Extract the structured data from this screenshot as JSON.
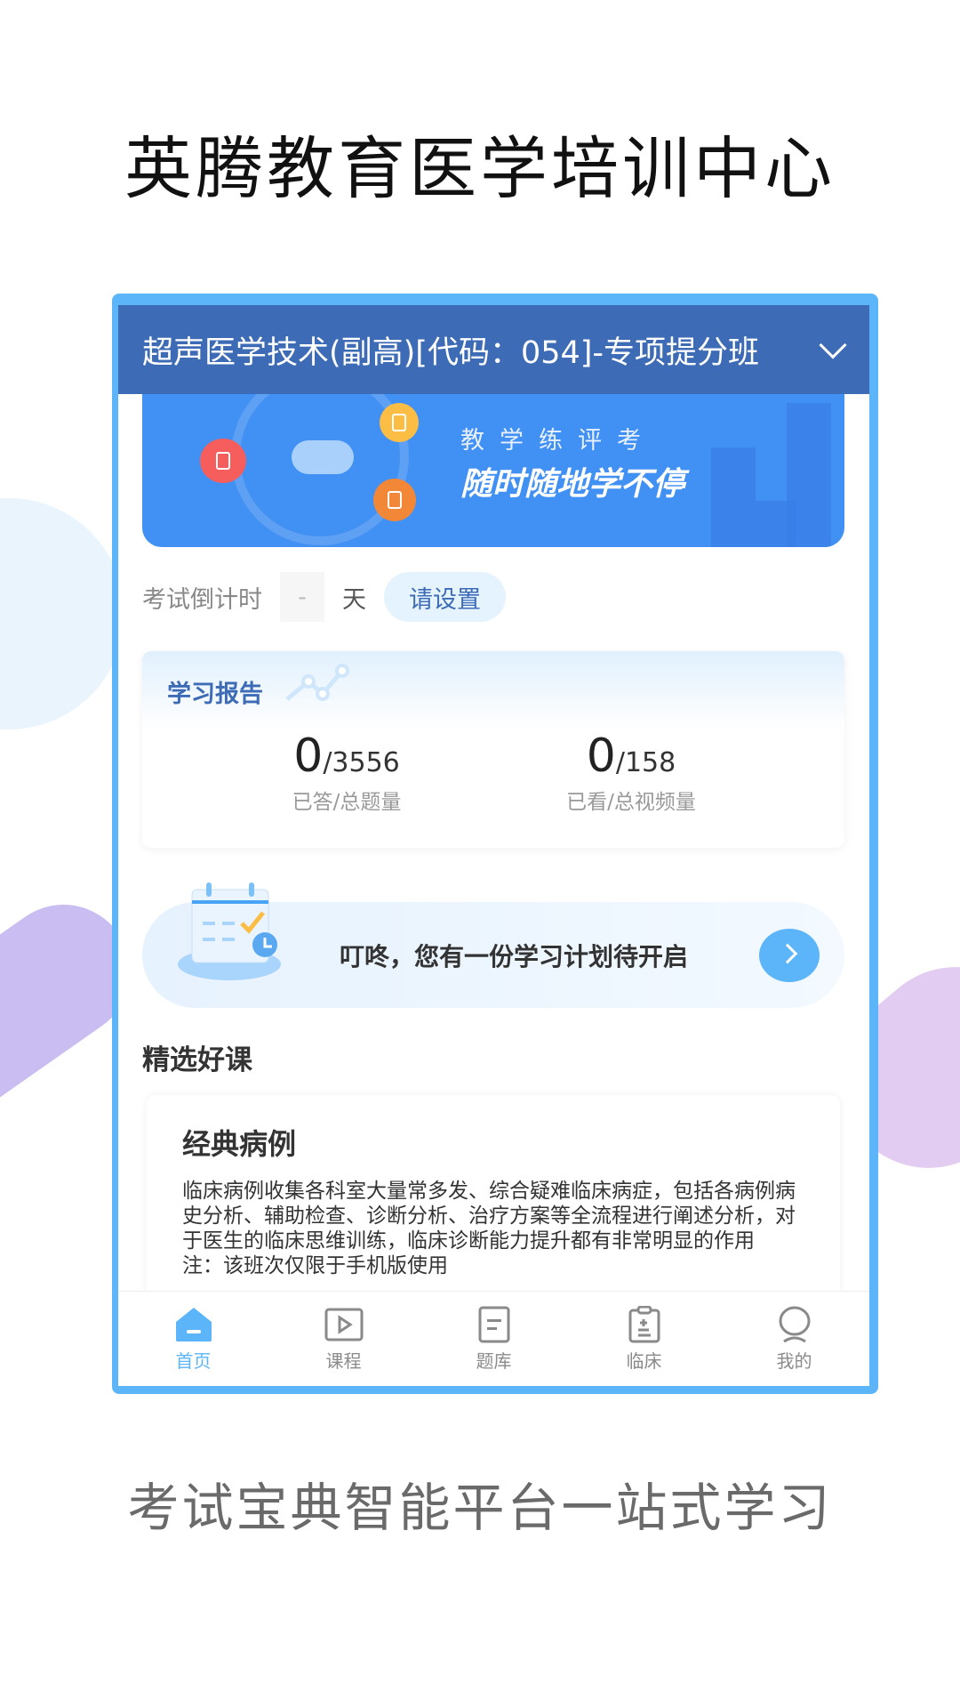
{
  "title": "英腾教育医学培训中心",
  "caption": "考试宝典智能平台一站式学习",
  "header": {
    "course_selector": "超声医学技术(副高)[代码：054]-专项提分班"
  },
  "banner": {
    "line1": "教学练评考",
    "line2": "随时随地学不停"
  },
  "countdown": {
    "label": "考试倒计时",
    "days": "-",
    "unit": "天",
    "set_button": "请设置"
  },
  "report": {
    "title": "学习报告",
    "stats": [
      {
        "done": "0",
        "total": "/3556",
        "label": "已答/总题量"
      },
      {
        "done": "0",
        "total": "/158",
        "label": "已看/总视频量"
      }
    ]
  },
  "plan": {
    "text": "叮咚，您有一份学习计划待开启"
  },
  "section": {
    "title": "精选好课"
  },
  "course": {
    "title": "经典病例",
    "description": "临床病例收集各科室大量常多发、综合疑难临床病症，包括各病例病史分析、辅助检查、诊断分析、治疗方案等全流程进行阐述分析，对于医生的临床思维训练，临床诊断能力提升都有非常明显的作用",
    "note": "注：该班次仅限于手机版使用"
  },
  "tabs": [
    {
      "label": "首页",
      "icon": "home-icon",
      "active": true
    },
    {
      "label": "课程",
      "icon": "play-icon"
    },
    {
      "label": "题库",
      "icon": "document-icon"
    },
    {
      "label": "临床",
      "icon": "clipboard-icon"
    },
    {
      "label": "我的",
      "icon": "user-icon"
    }
  ],
  "colors": {
    "accent": "#5bb5f8",
    "header": "#3d6bb5",
    "banner": "#4190f3"
  }
}
